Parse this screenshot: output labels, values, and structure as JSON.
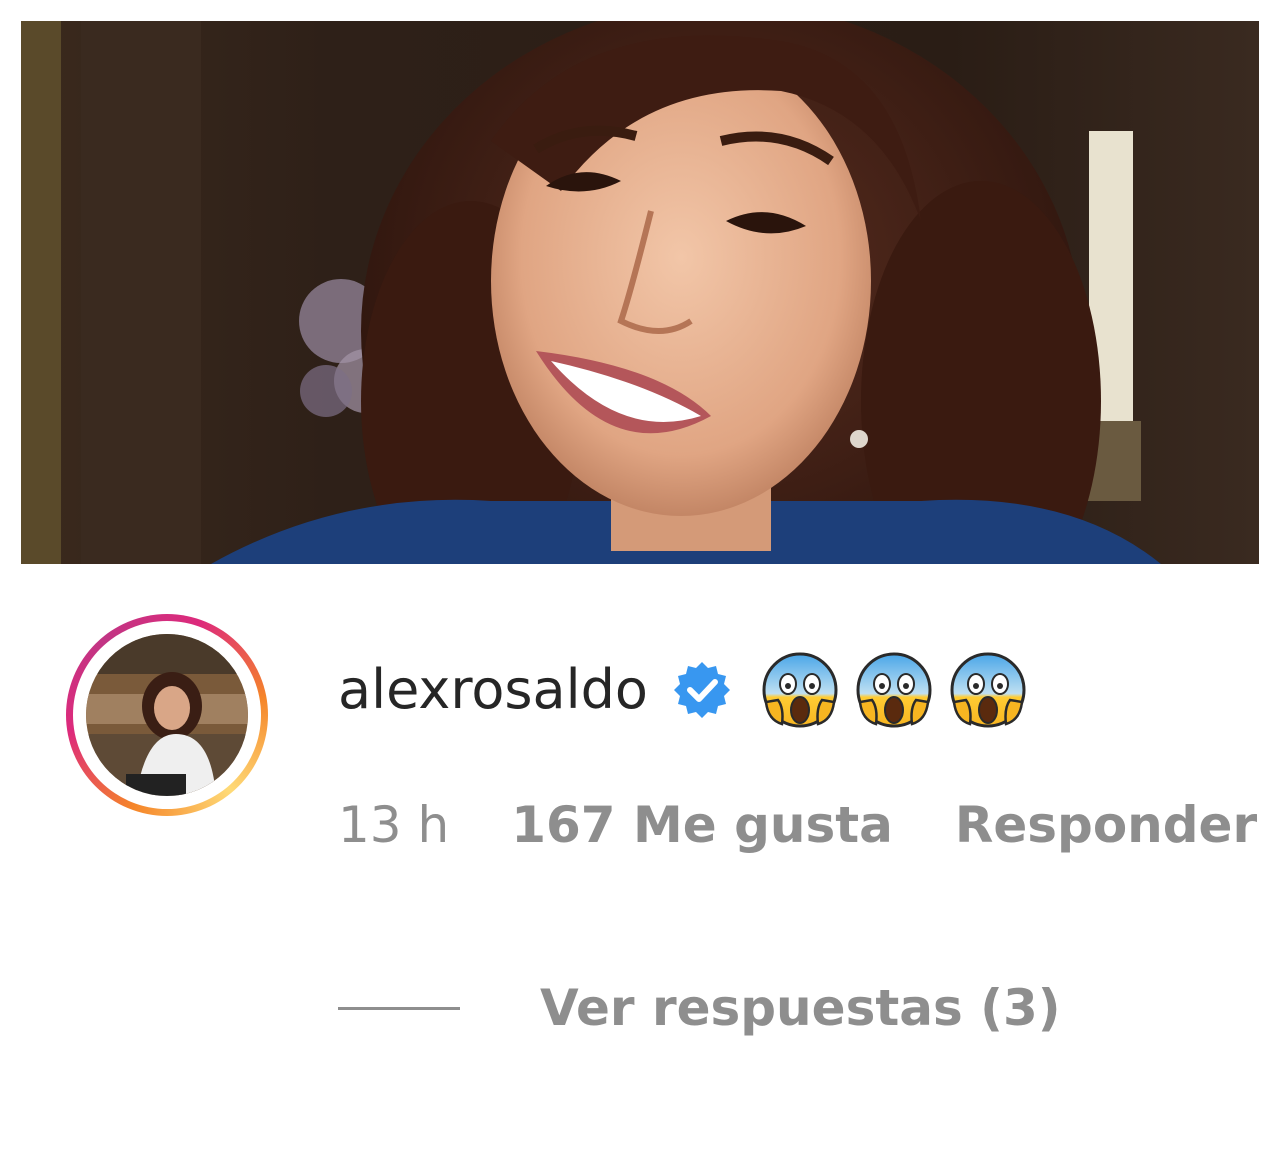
{
  "post": {
    "photo_subject": "smiling-woman-photo"
  },
  "comment": {
    "username": "alexrosaldo",
    "verified_icon": "verified-badge-icon",
    "emoji_text": "😱😱😱",
    "emojis": [
      "😱",
      "😱",
      "😱"
    ],
    "time": "13 h",
    "likes": "167 Me gusta",
    "reply_label": "Responder",
    "view_replies_label": "Ver respuestas (3)"
  },
  "colors": {
    "username": "#262626",
    "meta": "#8e8e8e",
    "verified": "#3897f0",
    "ring_start": "#f58529",
    "ring_end": "#dd2a7b"
  }
}
